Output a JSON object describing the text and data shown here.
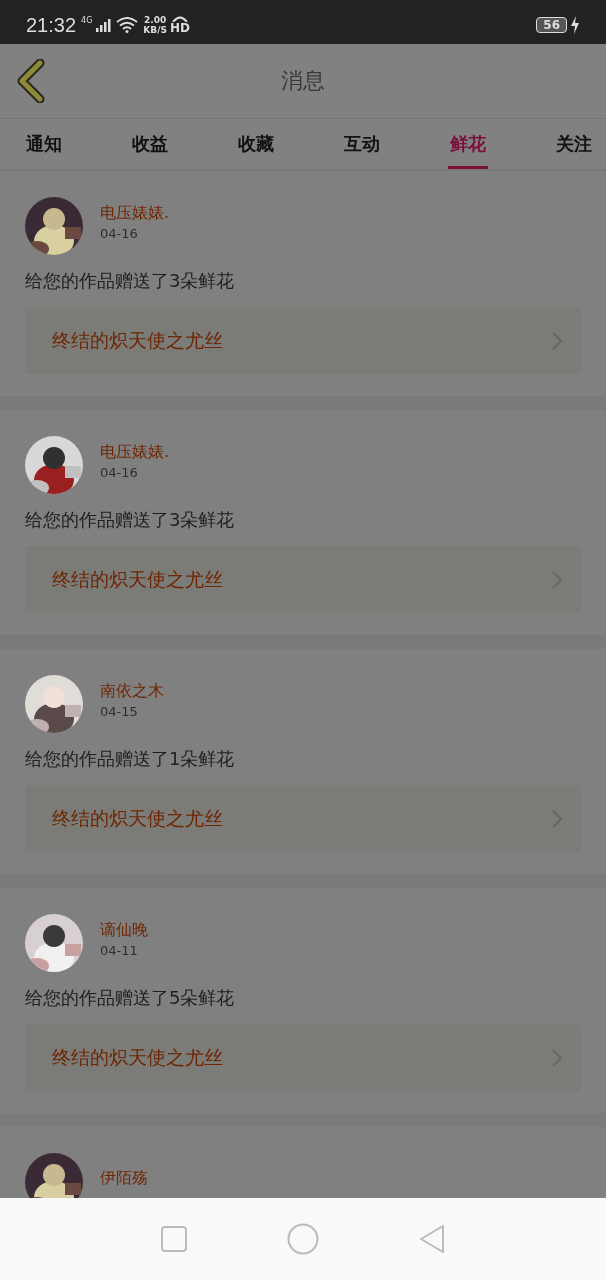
{
  "status_bar": {
    "time": "21:32",
    "network": "4G",
    "speed": "2.00",
    "speed_unit": "KB/S",
    "hd": "HD",
    "battery": "56"
  },
  "header": {
    "title": "消息"
  },
  "tabs": [
    {
      "label": "通知",
      "selected": false
    },
    {
      "label": "收益",
      "selected": false
    },
    {
      "label": "收藏",
      "selected": false
    },
    {
      "label": "互动",
      "selected": false
    },
    {
      "label": "鲜花",
      "selected": true
    },
    {
      "label": "关注",
      "selected": false
    }
  ],
  "messages": [
    {
      "name": "电压婊婊.",
      "date": "04-16",
      "text": "给您的作品赠送了3朵鲜花",
      "work": "终结的炽天使之尤丝"
    },
    {
      "name": "电压婊婊.",
      "date": "04-16",
      "text": "给您的作品赠送了3朵鲜花",
      "work": "终结的炽天使之尤丝"
    },
    {
      "name": "南依之木",
      "date": "04-15",
      "text": "给您的作品赠送了1朵鲜花",
      "work": "终结的炽天使之尤丝"
    },
    {
      "name": "谪仙晚",
      "date": "04-11",
      "text": "给您的作品赠送了5朵鲜花",
      "work": "终结的炽天使之尤丝"
    },
    {
      "name": "伊陌殇"
    }
  ]
}
